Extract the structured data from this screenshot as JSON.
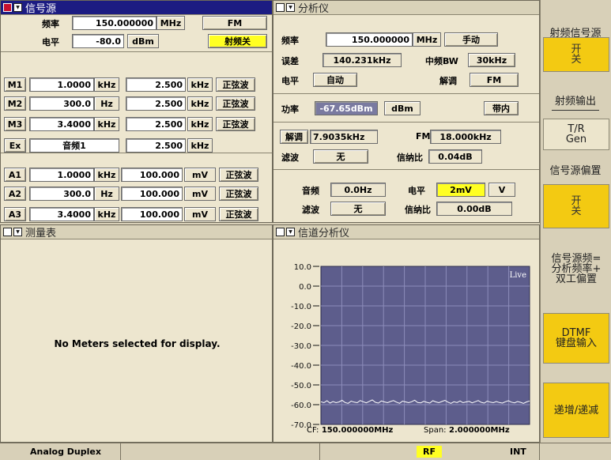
{
  "sig": {
    "title": "信号源",
    "freq_label": "频率",
    "freq_value": "150.000000",
    "freq_unit": "MHz",
    "mode": "FM",
    "level_label": "电平",
    "level_value": "-80.0",
    "level_unit": "dBm",
    "rf_switch": "射频关",
    "mods": [
      {
        "name": "M1",
        "freq": "1.0000",
        "funit": "kHz",
        "amp": "2.500",
        "aunit": "kHz",
        "wave": "正弦波"
      },
      {
        "name": "M2",
        "freq": "300.0",
        "funit": "Hz",
        "amp": "2.500",
        "aunit": "kHz",
        "wave": "正弦波"
      },
      {
        "name": "M3",
        "freq": "3.4000",
        "funit": "kHz",
        "amp": "2.500",
        "aunit": "kHz",
        "wave": "正弦波"
      }
    ],
    "ex": {
      "name": "Ex",
      "source": "音频1",
      "amp": "2.500",
      "aunit": "kHz"
    },
    "auds": [
      {
        "name": "A1",
        "freq": "1.0000",
        "funit": "kHz",
        "amp": "100.000",
        "aunit": "mV",
        "wave": "正弦波"
      },
      {
        "name": "A2",
        "freq": "300.0",
        "funit": "Hz",
        "amp": "100.000",
        "aunit": "mV",
        "wave": "正弦波"
      },
      {
        "name": "A3",
        "freq": "3.4000",
        "funit": "kHz",
        "amp": "100.000",
        "aunit": "mV",
        "wave": "正弦波"
      }
    ]
  },
  "ana": {
    "title": "分析仪",
    "freq_label": "频率",
    "freq_value": "150.000000",
    "freq_unit": "MHz",
    "tune": "手动",
    "err_label": "误差",
    "err_value": "140.231kHz",
    "ifbw_label": "中频BW",
    "ifbw_value": "30kHz",
    "level_label": "电平",
    "level_value": "自动",
    "demod_label": "解调",
    "demod_value": "FM",
    "power_label": "功率",
    "power_value": "-67.65dBm",
    "power_unit": "dBm",
    "inband": "带内",
    "demod_btn": "解调",
    "demod_meas": "7.9035kHz",
    "fm_label": "FM",
    "fm_value": "18.000kHz",
    "filt_label": "滤波",
    "filt_value": "无",
    "sinad_label": "信纳比",
    "sinad_value": "0.04dB",
    "audio_label": "音频",
    "audio_value": "0.0Hz",
    "alevel_label": "电平",
    "alevel_value": "2mV",
    "alevel_unit": "V",
    "afilt_label": "滤波",
    "afilt_value": "无",
    "asinad_label": "信纳比",
    "asinad_value": "0.00dB"
  },
  "meter": {
    "title": "测量表",
    "empty": "No Meters selected for display."
  },
  "chan": {
    "title": "信道分析仪",
    "live": "Live",
    "cf_label": "CF:",
    "cf_value": "150.000000MHz",
    "span_label": "Span:",
    "span_value": "2.000000MHz"
  },
  "chart_data": {
    "type": "line",
    "ylim": [
      -70,
      10
    ],
    "yticks": [
      "10.0",
      "0.0",
      "-10.0",
      "-20.0",
      "-30.0",
      "-40.0",
      "-50.0",
      "-60.0",
      "-70.0"
    ],
    "grid": true,
    "series": [
      {
        "values": [
          -58.5,
          -59,
          -58,
          -59.2,
          -58.4,
          -59,
          -58.6,
          -57.8,
          -58.9,
          -59.3,
          -58.2,
          -58.7,
          -59,
          -57.9,
          -58.5,
          -59.1,
          -58.3,
          -57.6,
          -58.8,
          -59.2,
          -58.1,
          -58.6,
          -59,
          -58.4,
          -57.9,
          -58.7,
          -59.3,
          -58.2,
          -58.6,
          -59,
          -58.5,
          -57.7,
          -58.9,
          -59.1,
          -58.3,
          -58.8,
          -59.2,
          -58,
          -58.6,
          -59,
          -58.4,
          -57.8,
          -58.7,
          -59.3,
          -58.5,
          -58.9,
          -58.1,
          -59,
          -58.6,
          -58.3,
          -59.1,
          -58.5,
          -57.9,
          -58.8,
          -59.2,
          -58.2,
          -58.7,
          -59,
          -58.4,
          -58.9,
          -59.2,
          -58.5,
          -58,
          -58.7,
          -59.1,
          -58.4,
          -58.8,
          -59.3,
          -58.6,
          -58.1
        ]
      }
    ]
  },
  "side": {
    "k1": "射频信号源",
    "k1b": "开\n关",
    "k2": "射频输出",
    "k2b": "T/R\nGen",
    "k3": "信号源偏置",
    "k3b": "开\n关",
    "k4": "信号源频=\n分析频率+\n双工偏置",
    "k5": "DTMF\n键盘输入",
    "k6": "递增/递减"
  },
  "status": {
    "mode": "Analog Duplex",
    "rf": "RF",
    "ref": "INT"
  }
}
